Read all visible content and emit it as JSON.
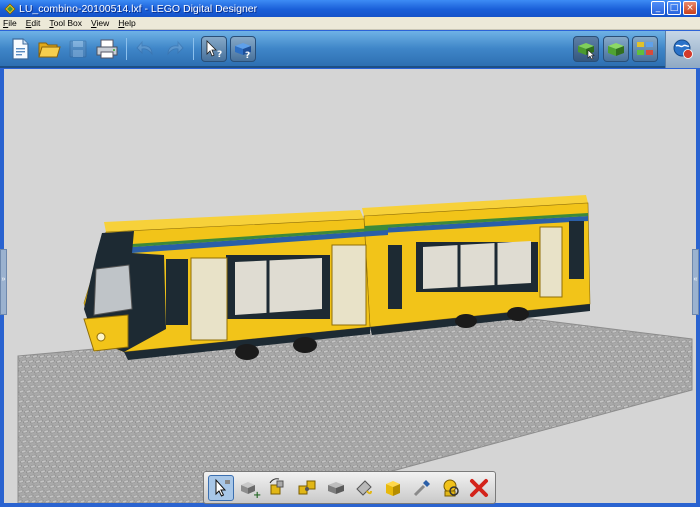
{
  "window": {
    "title": "LU_combino-20100514.lxf - LEGO Digital Designer",
    "controls": {
      "minimize": "_",
      "maximize": "□",
      "close": "×"
    }
  },
  "menu": {
    "items": [
      "File",
      "Edit",
      "Tool Box",
      "View",
      "Help"
    ]
  },
  "toolbar": {
    "left_buttons": [
      {
        "name": "new-file-icon",
        "enabled": true
      },
      {
        "name": "open-folder-icon",
        "enabled": true
      },
      {
        "name": "save-icon",
        "enabled": false
      },
      {
        "name": "print-icon",
        "enabled": true
      },
      {
        "name": "undo-icon",
        "enabled": false
      },
      {
        "name": "redo-icon",
        "enabled": false
      },
      {
        "name": "pointer-help-icon",
        "enabled": true
      },
      {
        "name": "brick-help-icon",
        "enabled": true
      }
    ],
    "mode_buttons": [
      {
        "name": "build-mode-icon",
        "active": true
      },
      {
        "name": "view-mode-icon",
        "active": false
      },
      {
        "name": "building-guide-mode-icon",
        "active": false
      }
    ],
    "online_button": "lego-online-icon"
  },
  "canvas": {
    "background": "#d5d5d5",
    "model": "yellow articulated tram on a grey baseplate",
    "side_tab_left": "»",
    "side_tab_right": "«"
  },
  "palette": {
    "tools": [
      {
        "name": "select-tool-icon",
        "selected": true
      },
      {
        "name": "clone-tool-icon",
        "selected": false
      },
      {
        "name": "hinge-tool-icon",
        "selected": false
      },
      {
        "name": "hinge-align-tool-icon",
        "selected": false
      },
      {
        "name": "flex-tool-icon",
        "selected": false
      },
      {
        "name": "paint-bucket-tool-icon",
        "selected": false
      },
      {
        "name": "paint-color-swatch-icon",
        "selected": false
      },
      {
        "name": "eyedropper-tool-icon",
        "selected": false
      },
      {
        "name": "hide-tool-icon",
        "selected": false
      },
      {
        "name": "delete-tool-icon",
        "selected": false
      }
    ]
  },
  "colors": {
    "title_bar": "#1a5fd8",
    "toolbar": "#3f86c8",
    "tram_yellow": "#f2c419",
    "tram_dark": "#1d2a33",
    "stripe_blue": "#2a5fa8",
    "stripe_green": "#3d8a3a",
    "baseplate": "#a9a9a9"
  }
}
